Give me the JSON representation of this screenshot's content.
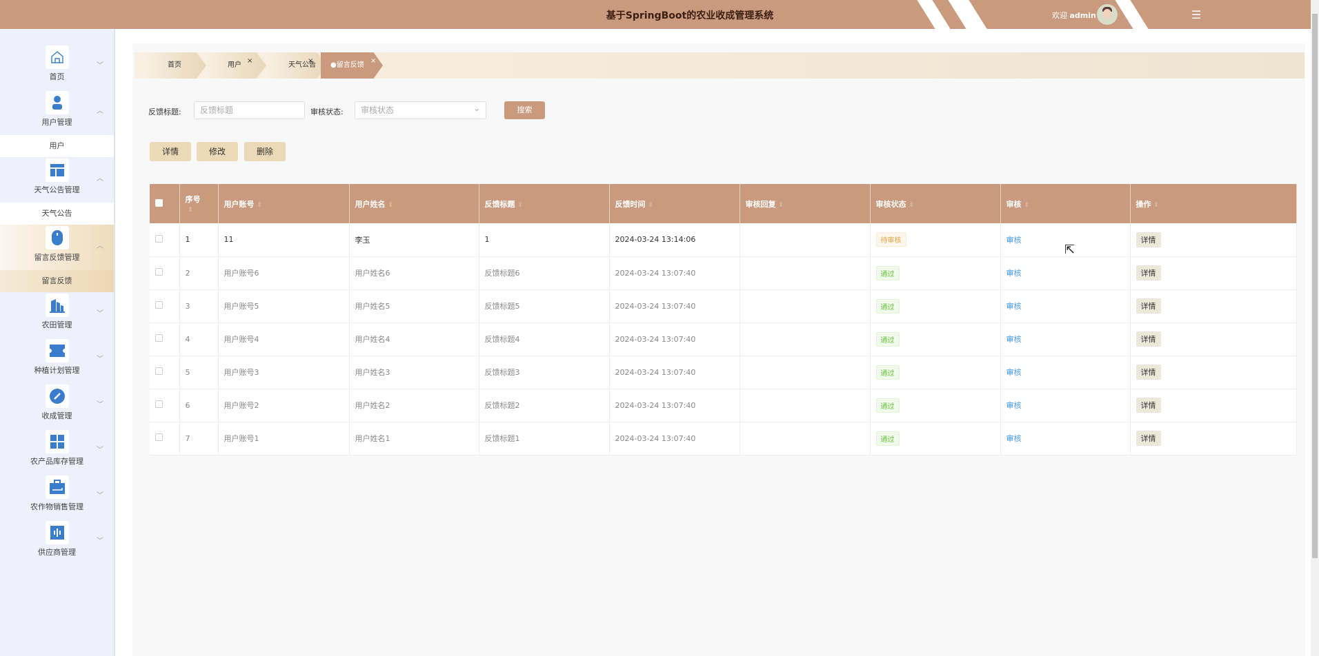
{
  "header": {
    "title": "基于SpringBoot的农业收成管理系统",
    "welcome": "欢迎",
    "user": "admin",
    "menu_icon": "☰"
  },
  "sidebar": {
    "items": [
      {
        "label": "首页",
        "icon": "home-icon",
        "expanded": false
      },
      {
        "label": "用户管理",
        "icon": "user-icon",
        "expanded": true,
        "sub": "用户"
      },
      {
        "label": "天气公告管理",
        "icon": "layout-icon",
        "expanded": true,
        "sub": "天气公告"
      },
      {
        "label": "留言反馈管理",
        "icon": "mouse-icon",
        "expanded": true,
        "sub": "留言反馈",
        "active": true
      },
      {
        "label": "农田管理",
        "icon": "building-icon",
        "expanded": false
      },
      {
        "label": "种植计划管理",
        "icon": "ticket-icon",
        "expanded": false
      },
      {
        "label": "收成管理",
        "icon": "compass-icon",
        "expanded": false
      },
      {
        "label": "农产品库存管理",
        "icon": "grid-icon",
        "expanded": false
      },
      {
        "label": "农作物销售管理",
        "icon": "briefcase-icon",
        "expanded": false
      },
      {
        "label": "供应商管理",
        "icon": "chart-icon",
        "expanded": false
      }
    ],
    "chev_down": "﹀",
    "chev_up": "︿"
  },
  "tabs": [
    {
      "label": "首页"
    },
    {
      "label": "用户",
      "close": "×"
    },
    {
      "label": "天气公告",
      "close": "×"
    },
    {
      "label": "●留言反馈",
      "close": "×",
      "active": true
    }
  ],
  "search": {
    "title_label": "反馈标题:",
    "title_placeholder": "反馈标题",
    "status_label": "审核状态:",
    "status_placeholder": "审核状态",
    "status_arrow": "⌄",
    "button": "搜索"
  },
  "actions": {
    "detail": "详情",
    "edit": "修改",
    "delete": "删除"
  },
  "table": {
    "headers": [
      "序号",
      "用户账号",
      "用户姓名",
      "反馈标题",
      "反馈时间",
      "审核回复",
      "审核状态",
      "审核",
      "操作"
    ],
    "sort_icon": "⇕",
    "rows": [
      {
        "no": "1",
        "account": "11",
        "name": "李玉",
        "title": "1",
        "time": "2024-03-24 13:14:06",
        "reply": "",
        "status": "待审核",
        "status_type": "pending",
        "audit": "审核",
        "op": "详情"
      },
      {
        "no": "2",
        "account": "用户账号6",
        "name": "用户姓名6",
        "title": "反馈标题6",
        "time": "2024-03-24 13:07:40",
        "reply": "",
        "status": "通过",
        "status_type": "pass",
        "audit": "审核",
        "op": "详情"
      },
      {
        "no": "3",
        "account": "用户账号5",
        "name": "用户姓名5",
        "title": "反馈标题5",
        "time": "2024-03-24 13:07:40",
        "reply": "",
        "status": "通过",
        "status_type": "pass",
        "audit": "审核",
        "op": "详情"
      },
      {
        "no": "4",
        "account": "用户账号4",
        "name": "用户姓名4",
        "title": "反馈标题4",
        "time": "2024-03-24 13:07:40",
        "reply": "",
        "status": "通过",
        "status_type": "pass",
        "audit": "审核",
        "op": "详情"
      },
      {
        "no": "5",
        "account": "用户账号3",
        "name": "用户姓名3",
        "title": "反馈标题3",
        "time": "2024-03-24 13:07:40",
        "reply": "",
        "status": "通过",
        "status_type": "pass",
        "audit": "审核",
        "op": "详情"
      },
      {
        "no": "6",
        "account": "用户账号2",
        "name": "用户姓名2",
        "title": "反馈标题2",
        "time": "2024-03-24 13:07:40",
        "reply": "",
        "status": "通过",
        "status_type": "pass",
        "audit": "审核",
        "op": "详情"
      },
      {
        "no": "7",
        "account": "用户账号1",
        "name": "用户姓名1",
        "title": "反馈标题1",
        "time": "2024-03-24 13:07:40",
        "reply": "",
        "status": "通过",
        "status_type": "pass",
        "audit": "审核",
        "op": "详情"
      }
    ]
  }
}
